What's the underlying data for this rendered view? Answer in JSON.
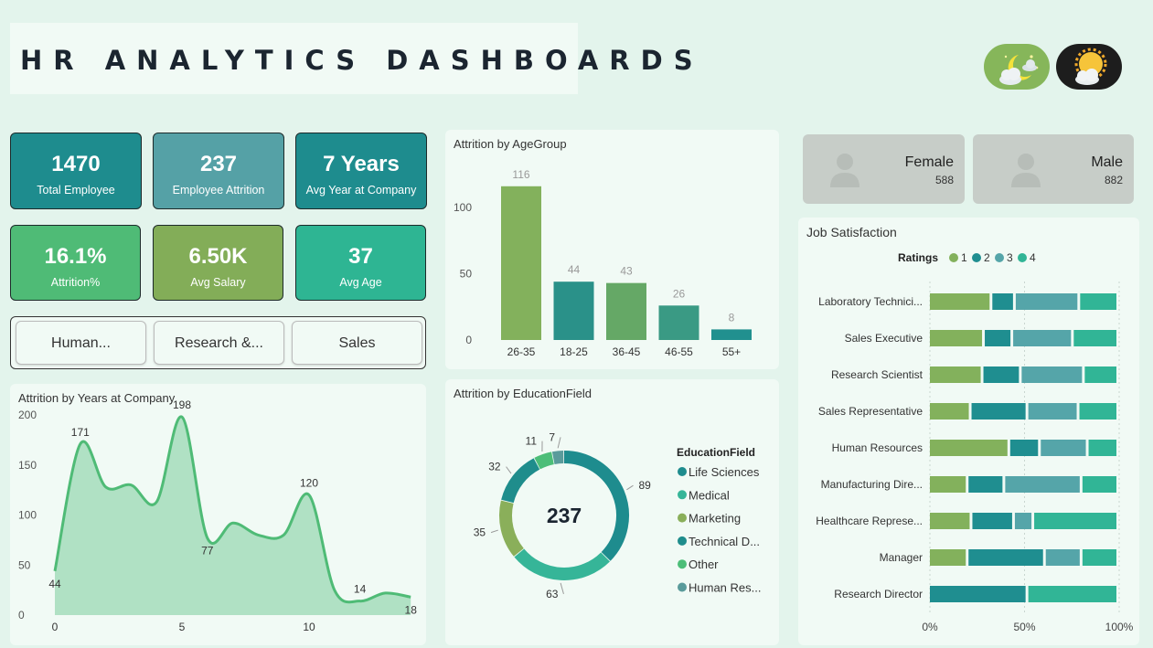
{
  "title": "HR ANALYTICS DASHBOARDS",
  "colors": {
    "teal_dark": "#1a8e8e",
    "teal": "#52a4a8",
    "green_mid": "#4fbb76",
    "olive": "#83ad58",
    "teal_green": "#2eb593"
  },
  "toggles": [
    {
      "icon": "moon-cloud-icon"
    },
    {
      "icon": "sun-cloud-icon"
    }
  ],
  "kpis": [
    {
      "value": "1470",
      "label": "Total Employee"
    },
    {
      "value": "237",
      "label": "Employee Attrition"
    },
    {
      "value": "7 Years",
      "label": "Avg Year at Company"
    },
    {
      "value": "16.1%",
      "label": "Attrition%"
    },
    {
      "value": "6.50K",
      "label": "Avg Salary"
    },
    {
      "value": "37",
      "label": "Avg Age"
    }
  ],
  "department_slicer": [
    "Human...",
    "Research &...",
    "Sales"
  ],
  "gender": [
    {
      "label": "Female",
      "value": "588",
      "icon": "person-icon"
    },
    {
      "label": "Male",
      "value": "882",
      "icon": "person-icon"
    }
  ],
  "chart_data": [
    {
      "type": "bar",
      "title": "Attrition by AgeGroup",
      "categories": [
        "26-35",
        "18-25",
        "36-45",
        "46-55",
        "55+"
      ],
      "values": [
        116,
        44,
        43,
        26,
        8
      ],
      "colors": [
        "#83b15c",
        "#2a9189",
        "#65a866",
        "#3a9a84",
        "#21908f"
      ],
      "yticks": [
        0,
        50,
        100
      ],
      "ylim": [
        0,
        125
      ]
    },
    {
      "type": "area",
      "title": "Attrition by Years at Company",
      "x": [
        0,
        1,
        2,
        3,
        4,
        5,
        6,
        7,
        8,
        9,
        10,
        11,
        12,
        13,
        14
      ],
      "values": [
        44,
        171,
        128,
        130,
        113,
        198,
        77,
        92,
        80,
        80,
        120,
        25,
        14,
        22,
        18
      ],
      "labeled_points": [
        0,
        1,
        5,
        6,
        10,
        12,
        14
      ],
      "xticks": [
        0,
        5,
        10
      ],
      "yticks": [
        0,
        50,
        100,
        150,
        200
      ],
      "ylim": [
        0,
        200
      ]
    },
    {
      "type": "pie",
      "title": "Attrition by EducationField",
      "center_label": "237",
      "legend_title": "EducationField",
      "categories": [
        "Life Sciences",
        "Medical",
        "Marketing",
        "Technical D...",
        "Other",
        "Human Res..."
      ],
      "values": [
        89,
        63,
        35,
        32,
        11,
        7
      ],
      "colors": [
        "#1e8c8e",
        "#36b598",
        "#8aaf5a",
        "#1f8d8c",
        "#4cbe78",
        "#5a9b9b"
      ]
    },
    {
      "type": "bar",
      "orientation": "horizontal-stacked-100",
      "title": "Job Satisfaction",
      "legend_title": "Ratings",
      "series_names": [
        "1",
        "2",
        "3",
        "4"
      ],
      "series_colors": [
        "#83b15c",
        "#1f8e90",
        "#55a5a9",
        "#31b596"
      ],
      "categories": [
        "Laboratory Technici...",
        "Sales Executive",
        "Research Scientist",
        "Sales Representative",
        "Human Resources",
        "Manufacturing Dire...",
        "Healthcare Represe...",
        "Manager",
        "Research Director"
      ],
      "values": [
        [
          32,
          12,
          33,
          20
        ],
        [
          29,
          15,
          32,
          24
        ],
        [
          28,
          20,
          33,
          18
        ],
        [
          22,
          30,
          27,
          21
        ],
        [
          42,
          16,
          25,
          16
        ],
        [
          20,
          19,
          40,
          19
        ],
        [
          22,
          22,
          10,
          44
        ],
        [
          20,
          40,
          19,
          19
        ],
        [
          0,
          52,
          0,
          48
        ]
      ],
      "xticks": [
        "0%",
        "50%",
        "100%"
      ]
    }
  ]
}
